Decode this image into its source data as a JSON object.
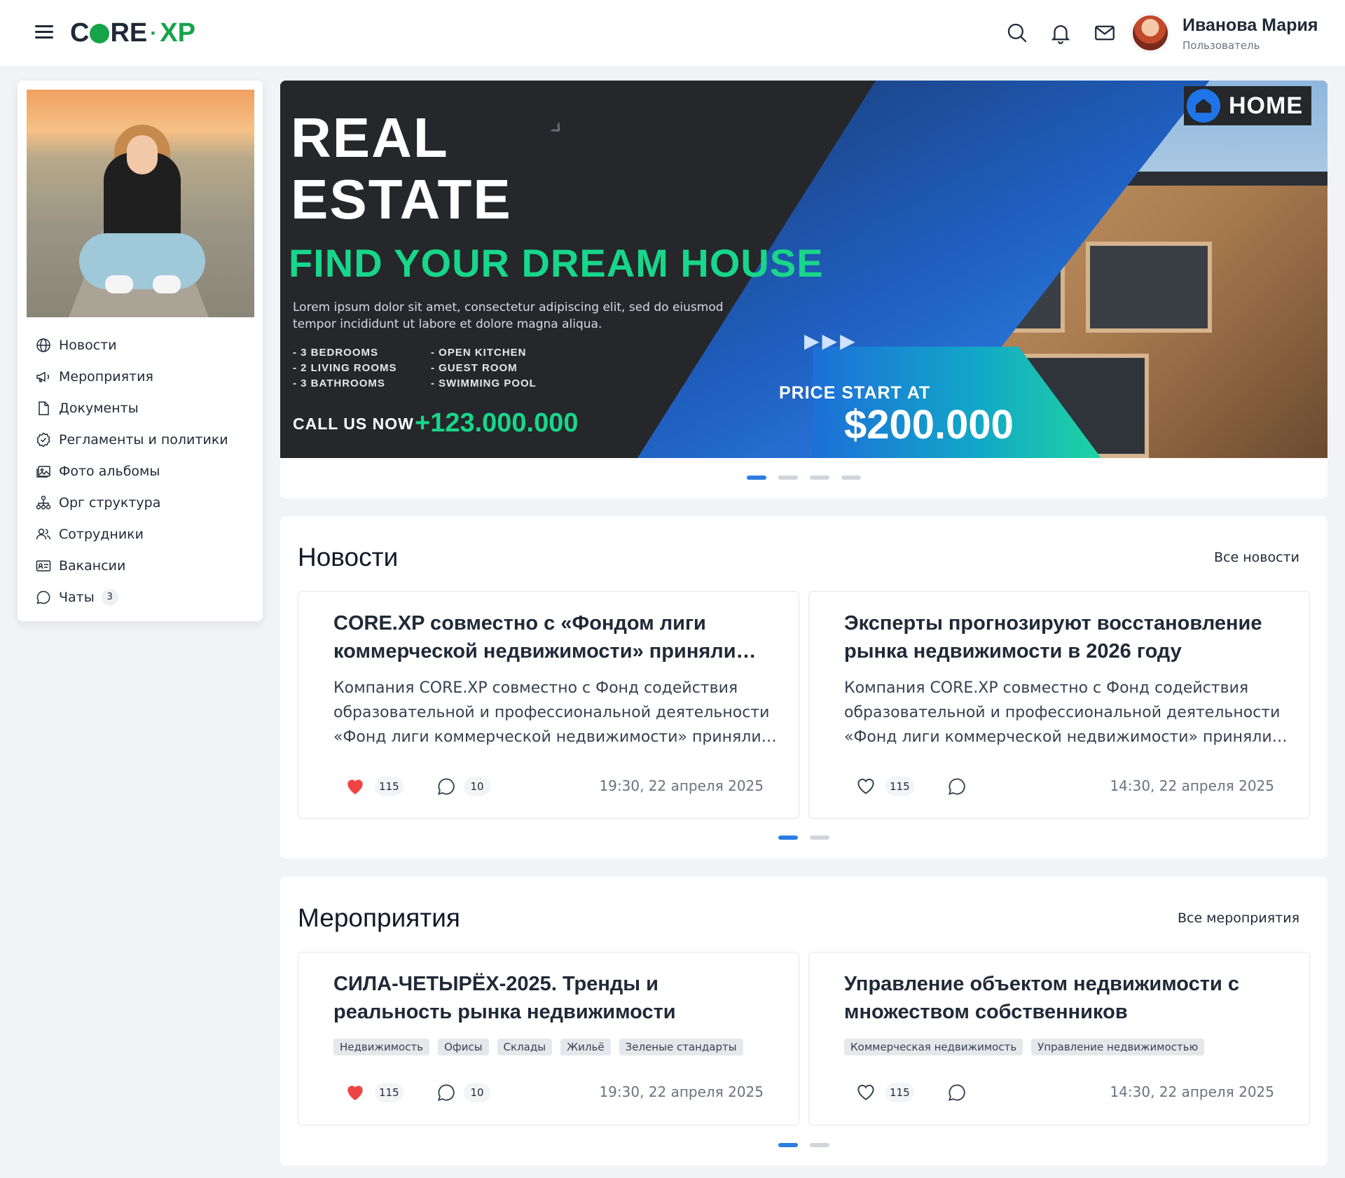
{
  "header": {
    "logo_text": "CORE·XP",
    "user": {
      "name": "Иванова Мария",
      "role": "Пользователь"
    },
    "icons": [
      "menu-icon",
      "search-icon",
      "bell-icon",
      "mail-icon"
    ]
  },
  "sidebar": {
    "items": [
      {
        "label": "Новости",
        "icon": "globe-icon"
      },
      {
        "label": "Мероприятия",
        "icon": "megaphone-icon"
      },
      {
        "label": "Документы",
        "icon": "document-icon"
      },
      {
        "label": "Регламенты и политики",
        "icon": "badge-check-icon"
      },
      {
        "label": "Фото альбомы",
        "icon": "photos-icon"
      },
      {
        "label": "Орг структура",
        "icon": "org-chart-icon"
      },
      {
        "label": "Сотрудники",
        "icon": "users-icon"
      },
      {
        "label": "Вакансии",
        "icon": "id-card-icon"
      },
      {
        "label": "Чаты",
        "icon": "chat-icon",
        "badge": "3"
      }
    ]
  },
  "banner": {
    "title_line1": "REAL",
    "title_line2": "ESTATE",
    "subtitle": "FIND YOUR DREAM HOUSE",
    "lorem": "Lorem ipsum dolor sit amet, consectetur adipiscing elit, sed do eiusmod tempor incididunt ut labore et dolore magna aliqua.",
    "features_left": [
      "-   3 BEDROOMS",
      "-   2 LIVING ROOMS",
      "-   3 BATHROOMS"
    ],
    "features_right": [
      "-   OPEN KITCHEN",
      "-   GUEST ROOM",
      "-   SWIMMING POOL"
    ],
    "call_label": "CALL US NOW",
    "phone": "+123.000.000",
    "price_label": "PRICE START AT",
    "price": "$200.000",
    "brand": "HOME",
    "arrows": "▶▶▶",
    "slides": 4,
    "active_slide": 1
  },
  "news": {
    "title": "Новости",
    "all_link": "Все новости",
    "cards": [
      {
        "title": "CORE.XP совместно с «Фондом лиги коммерческой недвижимости» приняли…",
        "text_line1": "Компания CORE.XP совместно с Фонд содействия",
        "text_line2": "образовательной и профессиональной деятельности",
        "text_line3": "«Фонд лиги коммерческой недвижимости» приняли…",
        "liked": true,
        "likes": "115",
        "comments": "10",
        "date": "19:30, 22 апреля 2025"
      },
      {
        "title": "Эксперты прогнозируют восстановление рынка недвижимости в 2026 году",
        "text_line1": "Компания CORE.XP совместно с Фонд содействия",
        "text_line2": "образовательной и профессиональной деятельности",
        "text_line3": "«Фонд лиги коммерческой недвижимости» приняли…",
        "liked": false,
        "likes": "115",
        "comments": "",
        "date": "14:30, 22 апреля 2025"
      }
    ],
    "pages": 2,
    "active_page": 1
  },
  "events": {
    "title": "Мероприятия",
    "all_link": "Все мероприятия",
    "cards": [
      {
        "title": "СИЛА-ЧЕТЫРЁХ-2025. Тренды и реальность рынка недвижимости",
        "tags": [
          "Недвижимость",
          "Офисы",
          "Склады",
          "Жильё",
          "Зеленые стандарты"
        ],
        "liked": true,
        "likes": "115",
        "comments": "10",
        "date": "19:30, 22 апреля 2025"
      },
      {
        "title": "Управление объектом недвижимости с множеством собственников",
        "tags": [
          "Коммерческая недвижимость",
          "Управление недвижимостью"
        ],
        "liked": false,
        "likes": "115",
        "comments": "",
        "date": "14:30, 22 апреля 2025"
      }
    ],
    "pages": 2,
    "active_page": 1
  },
  "colors": {
    "accent": "#2b7de0",
    "brand_green": "#16a34a",
    "like_red": "#ef4444",
    "background": "#f1f3f6"
  }
}
